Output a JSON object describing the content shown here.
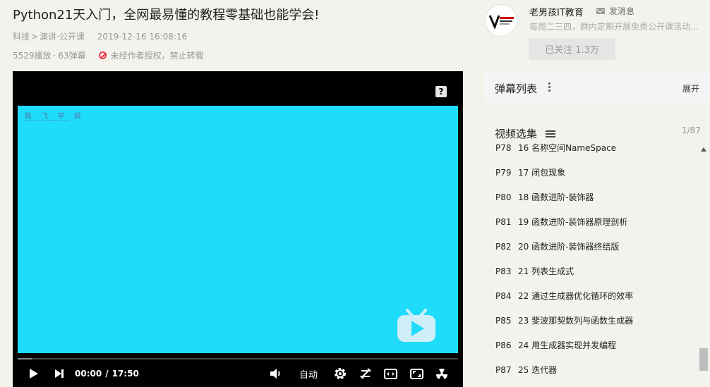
{
  "video": {
    "title": "Python21天入门，全网最易懂的教程零基础也能学会!",
    "category": "科技",
    "subcategory": "演讲·公开课",
    "category_sep": ">",
    "date": "2019-12-16 16:08:16",
    "plays": "5529播放",
    "dot": "·",
    "danmaku_count": "63弹幕",
    "copyright_notice": "未经作者授权，禁止转载"
  },
  "player": {
    "watermark": "路 飞 学 城",
    "help_label": "?",
    "current_time": "00:00",
    "time_sep": "/",
    "duration": "17:50",
    "auto_label": "自动",
    "progress": 0.0
  },
  "uploader": {
    "name": "老男孩IT教育",
    "message_label": "发消息",
    "description": "每周二三四，群内定期开展免费公开课活动，加群请联系",
    "follow_label": "已关注 1.3万"
  },
  "danmaku_panel": {
    "title": "弹幕列表",
    "expand_label": "展开"
  },
  "episodes": {
    "title": "视频选集",
    "count": "1/87",
    "items": [
      {
        "num": "P78",
        "title": "16 名称空间NameSpace"
      },
      {
        "num": "P79",
        "title": "17 闭包现象"
      },
      {
        "num": "P80",
        "title": "18 函数进阶-装饰器"
      },
      {
        "num": "P81",
        "title": "19 函数进阶-装饰器原理剖析"
      },
      {
        "num": "P82",
        "title": "20 函数进阶-装饰器终结版"
      },
      {
        "num": "P83",
        "title": "21 列表生成式"
      },
      {
        "num": "P84",
        "title": "22 通过生成器优化循环的效率"
      },
      {
        "num": "P85",
        "title": "23 斐波那契数列与函数生成器"
      },
      {
        "num": "P86",
        "title": "24 用生成器实现并发编程"
      },
      {
        "num": "P87",
        "title": "25 迭代器"
      }
    ]
  },
  "colors": {
    "screen": "#1fdcfa",
    "warning": "#e5394c",
    "page_bg": "#f4f2ec"
  }
}
